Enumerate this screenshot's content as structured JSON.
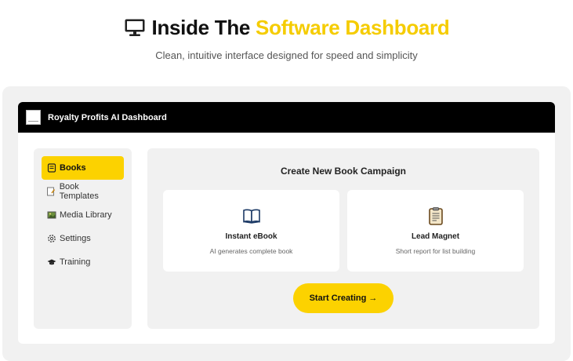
{
  "hero": {
    "title_main": "Inside The ",
    "title_accent": "Software Dashboard",
    "subtitle": "Clean, intuitive interface designed for speed and simplicity",
    "icon": "monitor-icon"
  },
  "app": {
    "title": "Royalty Profits AI Dashboard"
  },
  "sidebar": {
    "items": [
      {
        "label": "Books",
        "icon": "books-icon",
        "active": true
      },
      {
        "label": "Book Templates",
        "icon": "template-icon",
        "active": false
      },
      {
        "label": "Media Library",
        "icon": "image-icon",
        "active": false
      },
      {
        "label": "Settings",
        "icon": "gear-icon",
        "active": false
      },
      {
        "label": "Training",
        "icon": "graduation-cap-icon",
        "active": false
      }
    ]
  },
  "main": {
    "title": "Create New Book Campaign",
    "cards": [
      {
        "title": "Instant eBook",
        "desc": "AI generates complete book",
        "icon": "open-book-icon"
      },
      {
        "title": "Lead Magnet",
        "desc": "Short report for list building",
        "icon": "clipboard-icon"
      }
    ],
    "cta_label": "Start Creating →"
  },
  "colors": {
    "accent": "#fcd200",
    "titlebar": "#000000",
    "panel": "#f1f1f1"
  }
}
